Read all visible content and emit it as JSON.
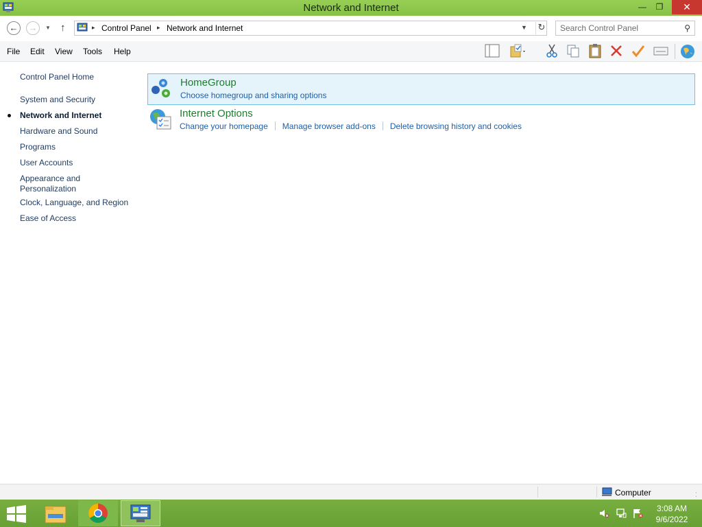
{
  "window": {
    "title": "Network and Internet"
  },
  "address": {
    "crumbs": [
      "Control Panel",
      "Network and Internet"
    ],
    "search_placeholder": "Search Control Panel"
  },
  "menu": [
    "File",
    "Edit",
    "View",
    "Tools",
    "Help"
  ],
  "toolbar_icons": [
    "layout-pane-icon",
    "folder-check-icon",
    "cut-icon",
    "copy-icon",
    "paste-icon",
    "delete-icon",
    "checkmark-icon",
    "properties-icon",
    "globe-icon"
  ],
  "nav": {
    "home": "Control Panel Home",
    "items": [
      {
        "label": "System and Security"
      },
      {
        "label": "Network and Internet",
        "current": true
      },
      {
        "label": "Hardware and Sound"
      },
      {
        "label": "Programs"
      },
      {
        "label": "User Accounts"
      },
      {
        "label": "Appearance and Personalization"
      },
      {
        "label": "Clock, Language, and Region"
      },
      {
        "label": "Ease of Access"
      }
    ]
  },
  "categories": [
    {
      "title": "HomeGroup",
      "icon": "homegroup-icon",
      "links": [
        "Choose homegroup and sharing options"
      ]
    },
    {
      "title": "Internet Options",
      "icon": "internet-options-icon",
      "links": [
        "Change your homepage",
        "Manage browser add-ons",
        "Delete browsing history and cookies"
      ]
    }
  ],
  "status": {
    "location": "Computer"
  },
  "taskbar": {
    "apps": [
      "file-explorer-icon",
      "chrome-icon",
      "control-panel-icon"
    ],
    "time": "3:08 AM",
    "date": "9/6/2022"
  },
  "colors": {
    "titlebar": "#8bc34a",
    "taskbar": "#6ea53a",
    "link": "#1f5fa6",
    "category_title": "#1e7b2f"
  }
}
